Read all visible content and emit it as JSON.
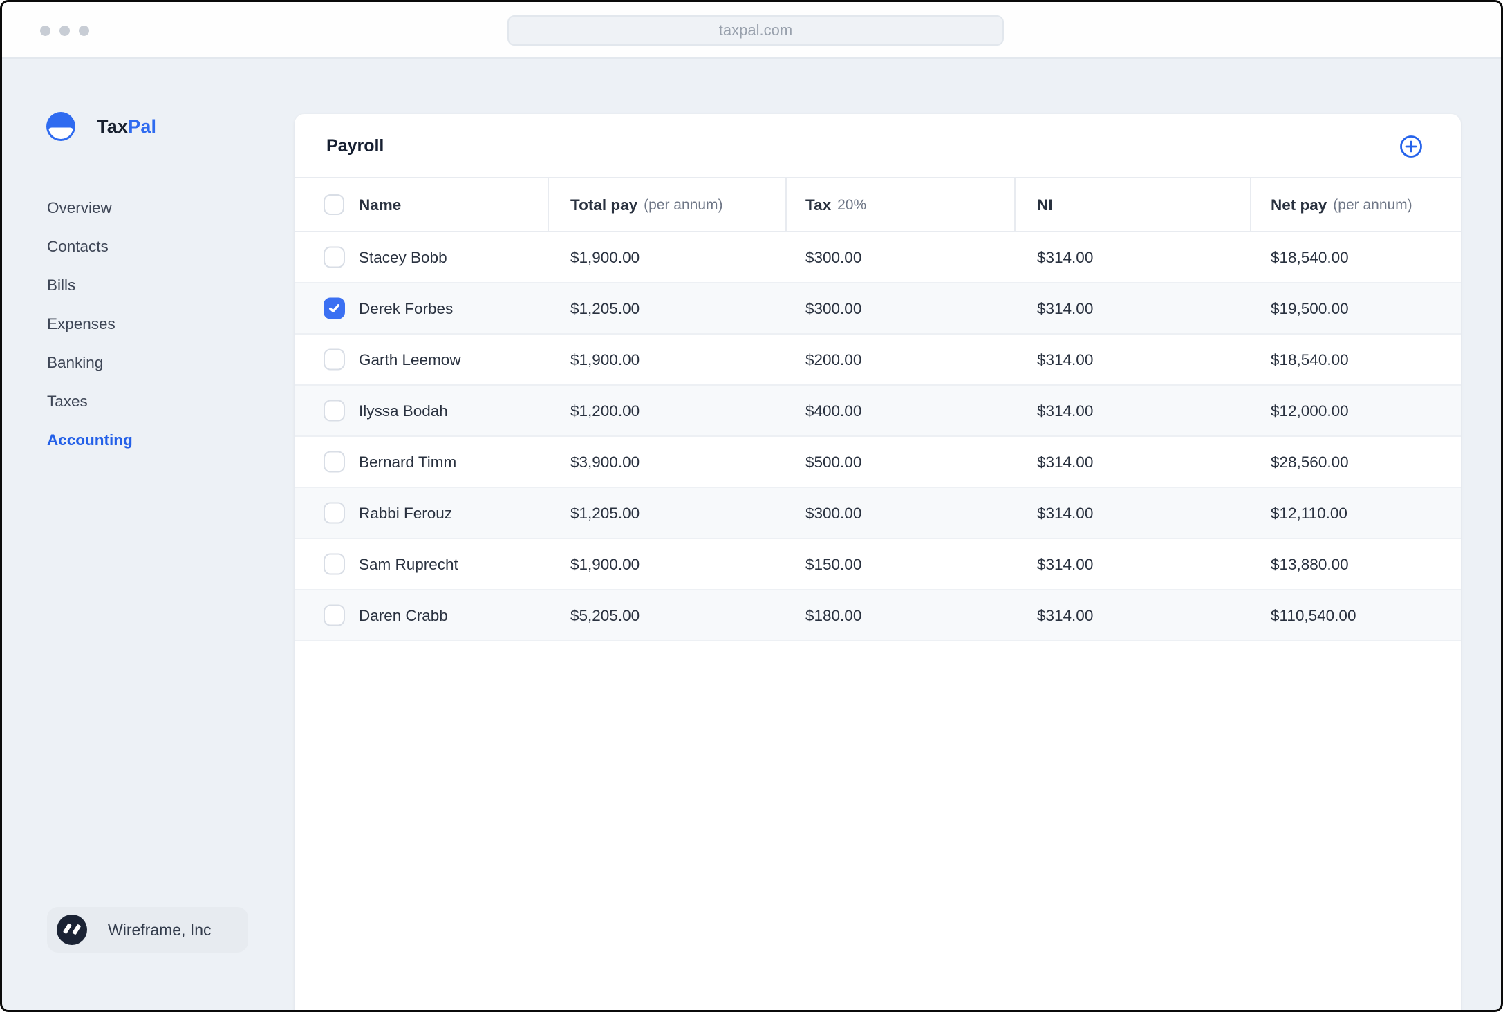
{
  "browser": {
    "url": "taxpal.com"
  },
  "brand": {
    "name_primary": "Tax",
    "name_secondary": "Pal"
  },
  "sidebar": {
    "items": [
      {
        "label": "Overview",
        "active": false
      },
      {
        "label": "Contacts",
        "active": false
      },
      {
        "label": "Bills",
        "active": false
      },
      {
        "label": "Expenses",
        "active": false
      },
      {
        "label": "Banking",
        "active": false
      },
      {
        "label": "Taxes",
        "active": false
      },
      {
        "label": "Accounting",
        "active": true
      }
    ],
    "workspace": {
      "name": "Wireframe, Inc"
    }
  },
  "payroll": {
    "title": "Payroll",
    "columns": [
      {
        "label": "Name",
        "sub": ""
      },
      {
        "label": "Total pay",
        "sub": "(per annum)"
      },
      {
        "label": "Tax",
        "sub": "20%"
      },
      {
        "label": "NI",
        "sub": ""
      },
      {
        "label": "Net pay",
        "sub": "(per annum)"
      }
    ],
    "rows": [
      {
        "name": "Stacey Bobb",
        "total_pay": "$1,900.00",
        "tax": "$300.00",
        "ni": "$314.00",
        "net_pay": "$18,540.00",
        "checked": false
      },
      {
        "name": "Derek Forbes",
        "total_pay": "$1,205.00",
        "tax": "$300.00",
        "ni": "$314.00",
        "net_pay": "$19,500.00",
        "checked": true
      },
      {
        "name": "Garth Leemow",
        "total_pay": "$1,900.00",
        "tax": "$200.00",
        "ni": "$314.00",
        "net_pay": "$18,540.00",
        "checked": false
      },
      {
        "name": "Ilyssa Bodah",
        "total_pay": "$1,200.00",
        "tax": "$400.00",
        "ni": "$314.00",
        "net_pay": "$12,000.00",
        "checked": false
      },
      {
        "name": "Bernard Timm",
        "total_pay": "$3,900.00",
        "tax": "$500.00",
        "ni": "$314.00",
        "net_pay": "$28,560.00",
        "checked": false
      },
      {
        "name": "Rabbi Ferouz",
        "total_pay": "$1,205.00",
        "tax": "$300.00",
        "ni": "$314.00",
        "net_pay": "$12,110.00",
        "checked": false
      },
      {
        "name": "Sam Ruprecht",
        "total_pay": "$1,900.00",
        "tax": "$150.00",
        "ni": "$314.00",
        "net_pay": "$13,880.00",
        "checked": false
      },
      {
        "name": "Daren Crabb",
        "total_pay": "$5,205.00",
        "tax": "$180.00",
        "ni": "$314.00",
        "net_pay": "$110,540.00",
        "checked": false
      }
    ]
  },
  "colors": {
    "accent_blue": "#2f6bf0",
    "checkbox_blue": "#3b70f2",
    "active_nav_blue": "#2460e8",
    "text_dark": "#29313f",
    "text_muted": "#6e7686",
    "page_background": "#edf1f6",
    "card_background": "#ffffff",
    "row_stripe": "#f7f9fb",
    "border": "#e8ebf0"
  }
}
